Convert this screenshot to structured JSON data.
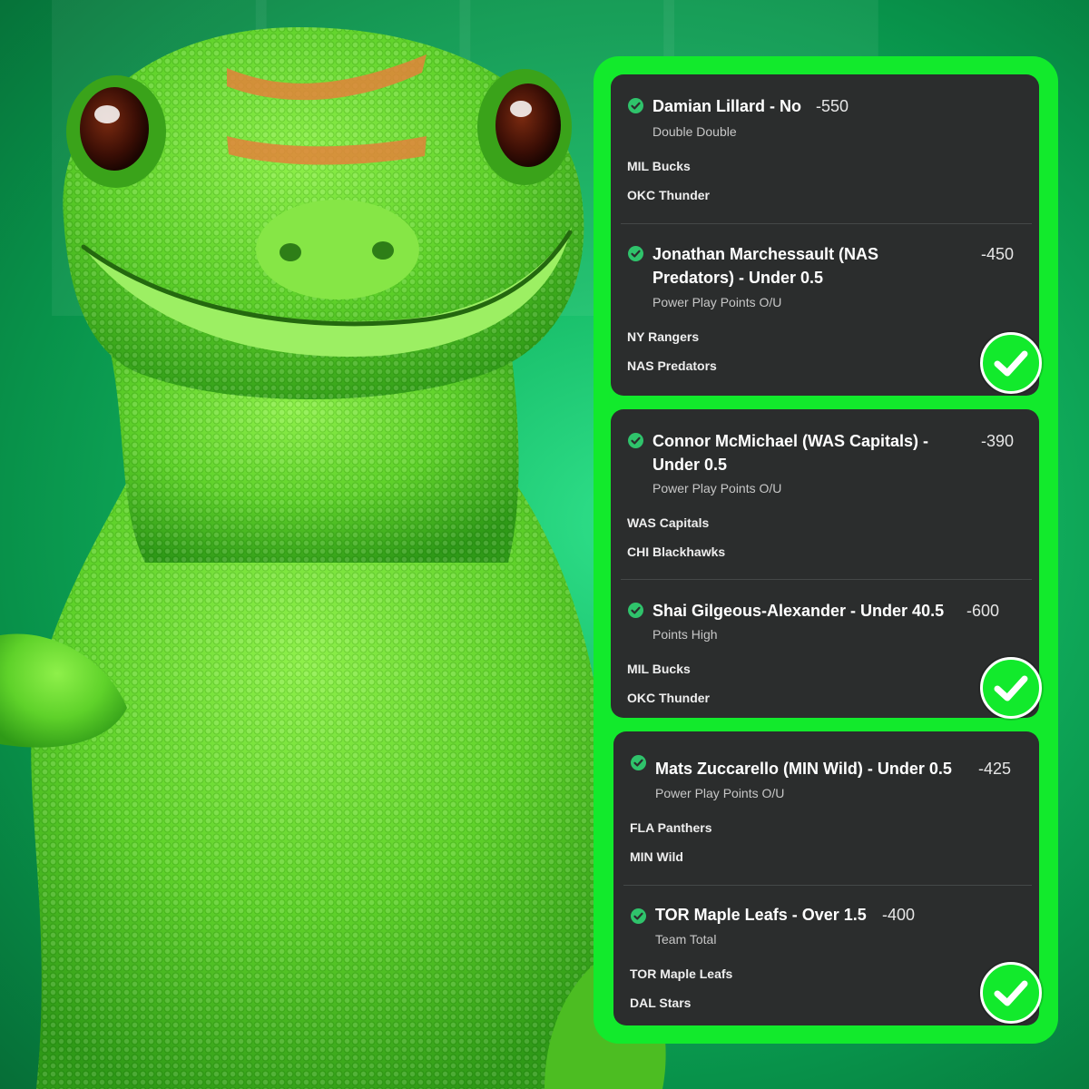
{
  "colors": {
    "frame": "#12ea2c",
    "card": "#2b2d2d",
    "check_dot": "#2fc36b",
    "background": "#14b763"
  },
  "icons": {
    "leg_status": "check-circle-icon",
    "slip_result": "big-check-badge-icon"
  },
  "slips": [
    {
      "legs": [
        {
          "selection": "Damian Lillard - No",
          "odds": "-550",
          "market": "Double Double",
          "team_1": "MIL Bucks",
          "team_2": "OKC Thunder"
        },
        {
          "selection": "Jonathan Marchessault (NAS Predators) - Under 0.5",
          "odds": "-450",
          "market": "Power Play Points O/U",
          "team_1": "NY Rangers",
          "team_2": "NAS Predators"
        }
      ],
      "result": "won"
    },
    {
      "legs": [
        {
          "selection": "Connor McMichael (WAS Capitals) - Under 0.5",
          "odds": "-390",
          "market": "Power Play Points O/U",
          "team_1": "WAS Capitals",
          "team_2": "CHI Blackhawks"
        },
        {
          "selection": "Shai Gilgeous-Alexander - Under 40.5",
          "odds": "-600",
          "market": "Points High",
          "team_1": "MIL Bucks",
          "team_2": "OKC Thunder"
        }
      ],
      "result": "won"
    },
    {
      "legs": [
        {
          "selection": "Mats Zuccarello (MIN Wild) - Under 0.5",
          "odds": "-425",
          "market": "Power Play Points O/U",
          "team_1": "FLA Panthers",
          "team_2": "MIN Wild"
        },
        {
          "selection": "TOR Maple Leafs - Over 1.5",
          "odds": "-400",
          "market": "Team Total",
          "team_1": "TOR Maple Leafs",
          "team_2": "DAL Stars"
        }
      ],
      "result": "won"
    }
  ]
}
